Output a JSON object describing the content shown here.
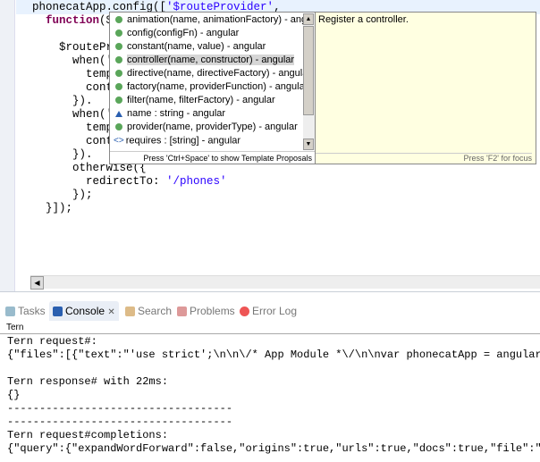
{
  "editor": {
    "lines": [
      [
        "phonecatApp.config([",
        "'$routeProvider'",
        ","
      ],
      [
        "  function($",
        "",
        ""
      ],
      [
        "",
        "",
        ""
      ],
      [
        "    $routePr",
        "",
        ""
      ],
      [
        "      when('",
        "",
        ""
      ],
      [
        "        temp",
        "",
        ""
      ],
      [
        "        cont",
        "",
        ""
      ],
      [
        "      }).",
        "",
        ""
      ],
      [
        "      when('",
        "",
        ""
      ],
      [
        "        temp",
        "",
        ""
      ],
      [
        "        cont",
        "",
        ""
      ],
      [
        "      }).",
        "",
        ""
      ],
      [
        "      otherwise({",
        "",
        ""
      ],
      [
        "        redirectTo: ",
        "'/phones'",
        ""
      ],
      [
        "      });",
        "",
        ""
      ],
      [
        "  }]);",
        "",
        ""
      ]
    ]
  },
  "completion": {
    "items": [
      {
        "label": "animation(name, animationFactory) - angular",
        "icon": "method-icon"
      },
      {
        "label": "config(configFn) - angular",
        "icon": "method-icon"
      },
      {
        "label": "constant(name, value) - angular",
        "icon": "method-icon"
      },
      {
        "label": "controller(name, constructor) - angular",
        "icon": "method-icon",
        "selected": true
      },
      {
        "label": "directive(name, directiveFactory) - angular",
        "icon": "method-icon"
      },
      {
        "label": "factory(name, providerFunction) - angular",
        "icon": "method-icon"
      },
      {
        "label": "filter(name, filterFactory) - angular",
        "icon": "method-icon"
      },
      {
        "label": "name : string - angular",
        "icon": "property-icon"
      },
      {
        "label": "provider(name, providerType) - angular",
        "icon": "method-icon"
      },
      {
        "label": "requires : [string] - angular",
        "icon": "array-icon"
      }
    ],
    "hint": "Press 'Ctrl+Space' to show Template Proposals"
  },
  "doc": {
    "text": "Register a controller.",
    "footer": "Press 'F2' for focus"
  },
  "tabs": [
    {
      "label": "Tasks"
    },
    {
      "label": "Console",
      "active": true
    },
    {
      "label": "Search"
    },
    {
      "label": "Problems"
    },
    {
      "label": "Error Log"
    }
  ],
  "console": {
    "name": "Tern",
    "text": "Tern request#:\n{\"files\":[{\"text\":\"'use strict';\\n\\n\\/* App Module *\\/\\n\\nvar phonecatApp = angular\n\nTern response# with 22ms:\n{}\n-----------------------------------\n-----------------------------------\nTern request#completions:\n{\"query\":{\"expandWordForward\":false,\"origins\":true,\"urls\":true,\"docs\":true,\"file\":\""
  }
}
